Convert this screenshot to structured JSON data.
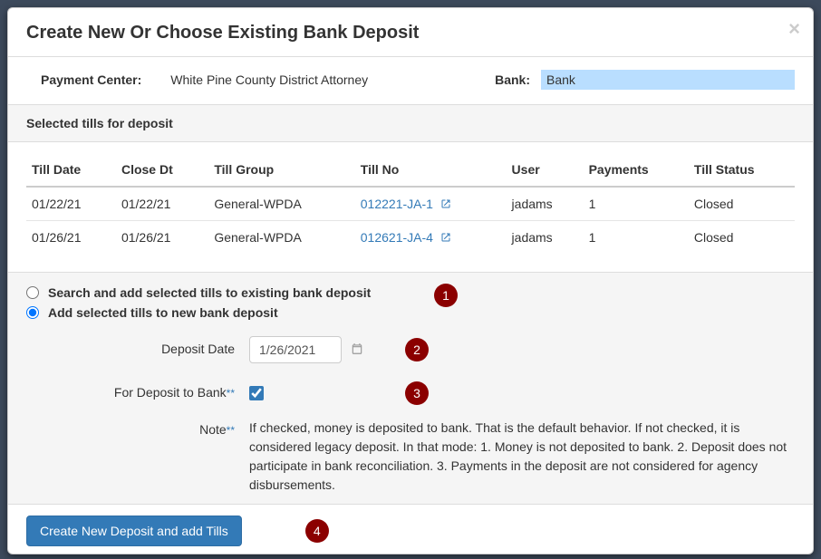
{
  "modal": {
    "title": "Create New Or Choose Existing Bank Deposit",
    "close": "×"
  },
  "filters": {
    "payment_center_label": "Payment Center:",
    "payment_center_value": "White Pine County District Attorney",
    "bank_label": "Bank:",
    "bank_value": "Bank"
  },
  "section_title": "Selected tills for deposit",
  "columns": {
    "till_date": "Till Date",
    "close_dt": "Close Dt",
    "till_group": "Till Group",
    "till_no": "Till No",
    "user": "User",
    "payments": "Payments",
    "till_status": "Till Status"
  },
  "rows": [
    {
      "till_date": "01/22/21",
      "close_dt": "01/22/21",
      "till_group": "General-WPDA",
      "till_no": "012221-JA-1",
      "user": "jadams",
      "payments": "1",
      "till_status": "Closed"
    },
    {
      "till_date": "01/26/21",
      "close_dt": "01/26/21",
      "till_group": "General-WPDA",
      "till_no": "012621-JA-4",
      "user": "jadams",
      "payments": "1",
      "till_status": "Closed"
    }
  ],
  "options": {
    "search_existing": "Search and add selected tills to existing bank deposit",
    "add_new": "Add selected tills to new bank deposit"
  },
  "form": {
    "deposit_date_label": "Deposit Date",
    "deposit_date_value": "1/26/2021",
    "for_deposit_label": "For Deposit to Bank",
    "note_label": "Note",
    "note_text": "If checked, money is deposited to bank. That is the default behavior. If not checked, it is considered legacy deposit. In that mode: 1. Money is not deposited to bank. 2. Deposit does not participate in bank reconciliation. 3. Payments in the deposit are not considered for agency disbursements."
  },
  "footer": {
    "submit": "Create New Deposit and add Tills"
  },
  "callouts": {
    "c1": "1",
    "c2": "2",
    "c3": "3",
    "c4": "4"
  }
}
